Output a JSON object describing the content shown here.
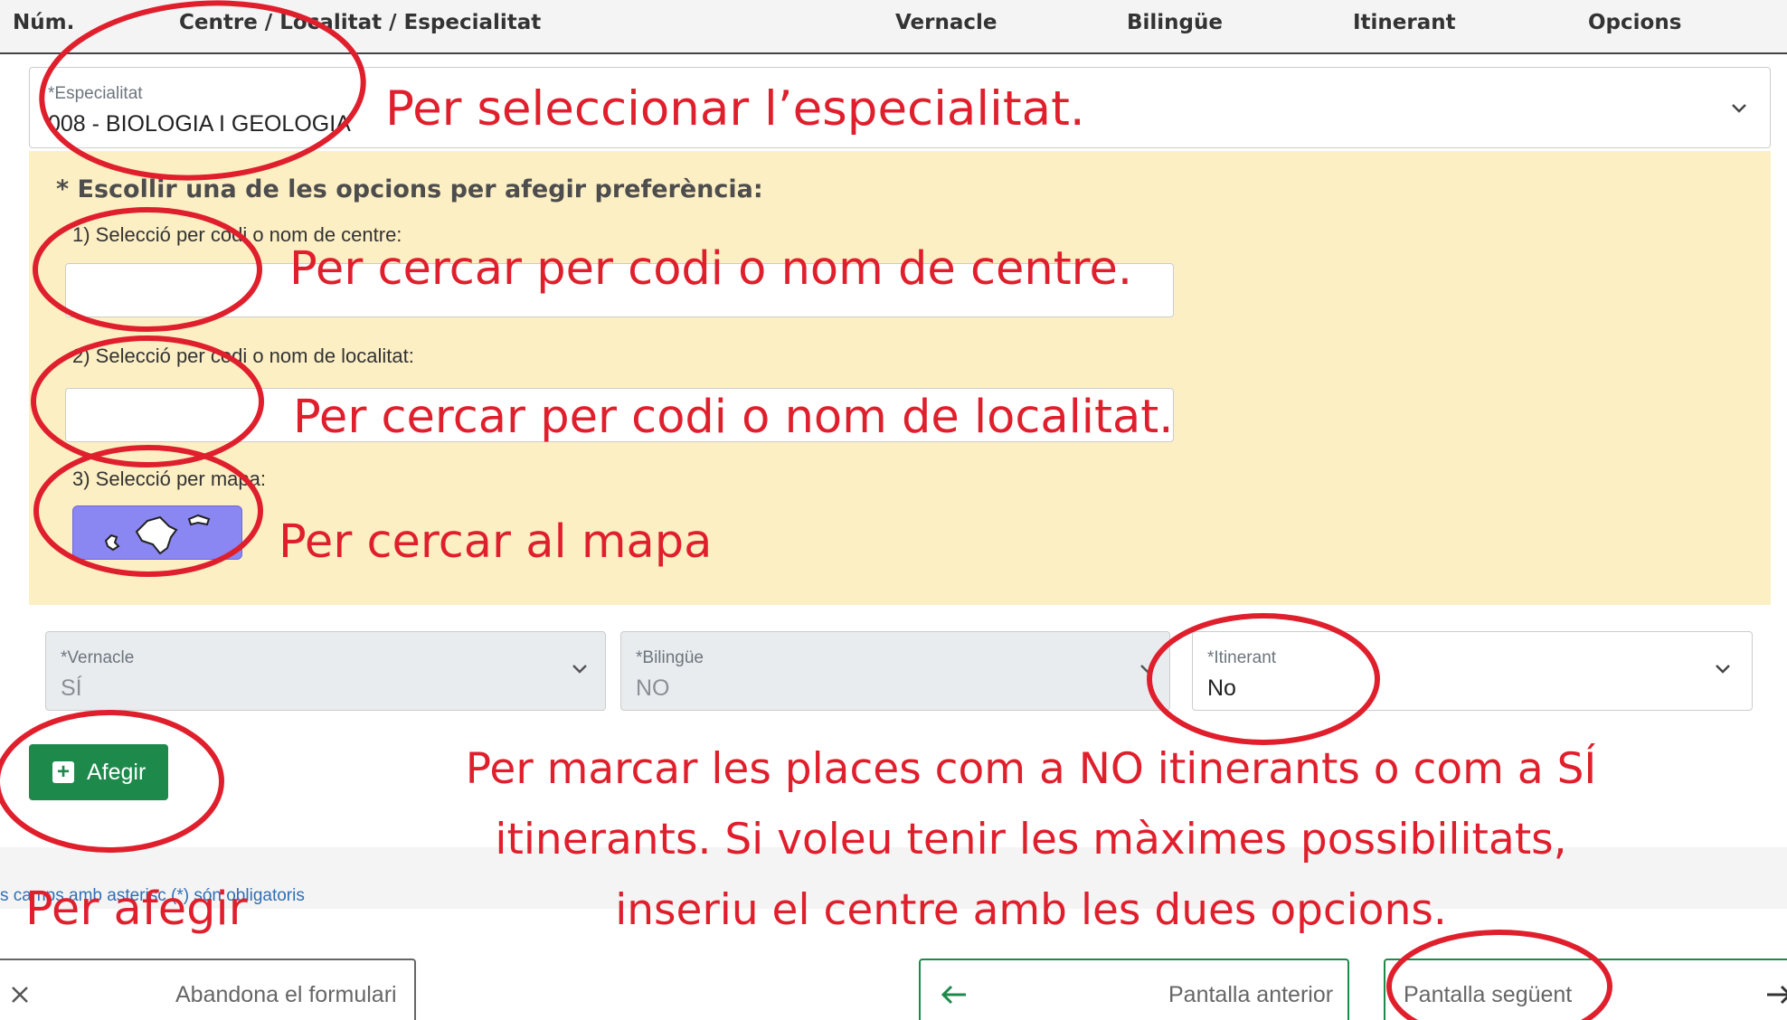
{
  "table_header": {
    "num": "Núm.",
    "centre": "Centre / Localitat / Especialitat",
    "vernacle": "Vernacle",
    "bilingue": "Bilingüe",
    "itinerant": "Itinerant",
    "opcions": "Opcions"
  },
  "especialitat": {
    "label": "*Especialitat",
    "value": "008 - BIOLOGIA I GEOLOGIA"
  },
  "panel": {
    "title": "* Escollir una de les opcions per afegir preferència:",
    "option1_label": "1) Selecció per codi o nom de centre:",
    "option2_label": "2) Selecció per codi o nom de localitat:",
    "option3_label": "3) Selecció per mapa:"
  },
  "selects": {
    "vernacle": {
      "label": "*Vernacle",
      "value": "SÍ"
    },
    "bilingue": {
      "label": "*Bilingüe",
      "value": "NO"
    },
    "itinerant": {
      "label": "*Itinerant",
      "value": "No"
    }
  },
  "add_button": {
    "label": "Afegir"
  },
  "required_note": "s camps amb asterisc (*) són obligatoris",
  "footer": {
    "abandon": "Abandona el formulari",
    "previous": "Pantalla anterior",
    "next": "Pantalla següent"
  },
  "annotations": {
    "especialitat": "Per seleccionar l’especialitat.",
    "centre": "Per cercar per codi o nom de centre.",
    "localitat": "Per cercar per codi o nom de localitat.",
    "mapa": "Per cercar al mapa",
    "itinerant_line1": "Per marcar les places com a NO itinerants o com a SÍ",
    "itinerant_line2": "itinerants. Si voleu tenir les màximes possibilitats,",
    "itinerant_line3": "inseriu el centre amb les dues opcions.",
    "afegir": "Per afegir"
  },
  "icons": {
    "chevron": "chevron-down-icon",
    "plus": "plus-square-icon",
    "map": "balearic-islands-map-icon",
    "close": "close-icon",
    "arrow_left": "arrow-left-icon",
    "arrow_right": "arrow-right-icon"
  },
  "colors": {
    "annotation_red": "#e01f2d",
    "panel_yellow": "#fdefc4",
    "button_green": "#1d8a4c",
    "map_button": "#8a86f2"
  }
}
